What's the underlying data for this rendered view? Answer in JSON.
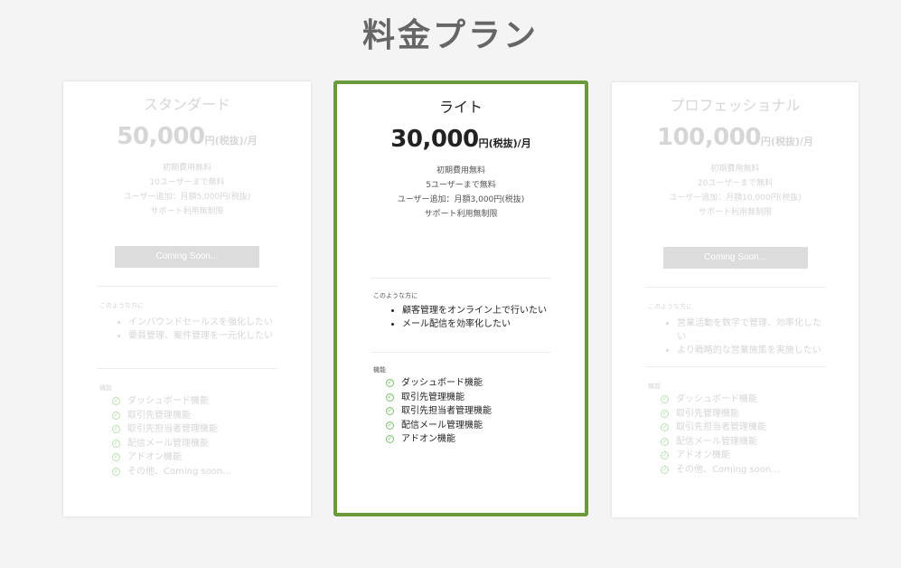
{
  "page": {
    "title": "料金プラン"
  },
  "plans": [
    {
      "name": "スタンダード",
      "price": "50,000",
      "unit": "円(税抜)/月",
      "summary": [
        "初期費用無料",
        "10ユーザーまで無料",
        "ユーザー追加：月額5,000円(税抜)",
        "サポート利用無制限"
      ],
      "cta": "Coming Soon...",
      "target_label": "このような方に",
      "targets": [
        "インバウンドセールスを強化したい",
        "要員管理、案件管理を一元化したい"
      ],
      "features_label": "機能",
      "features": [
        "ダッシュボード機能",
        "取引先管理機能",
        "取引先担当者管理機能",
        "配信メール管理機能",
        "アドオン機能",
        "その他、Coming soon..."
      ]
    },
    {
      "name": "ライト",
      "price": "30,000",
      "unit": "円(税抜)/月",
      "summary": [
        "初期費用無料",
        "5ユーザーまで無料",
        "ユーザー追加：月額3,000円(税抜)",
        "サポート利用無制限"
      ],
      "target_label": "このような方に",
      "targets": [
        "顧客管理をオンライン上で行いたい",
        "メール配信を効率化したい"
      ],
      "features_label": "機能",
      "features": [
        "ダッシュボード機能",
        "取引先管理機能",
        "取引先担当者管理機能",
        "配信メール管理機能",
        "アドオン機能"
      ]
    },
    {
      "name": "プロフェッショナル",
      "price": "100,000",
      "unit": "円(税抜)/月",
      "summary": [
        "初期費用無料",
        "20ユーザーまで無料",
        "ユーザー追加：月額10,000円(税抜)",
        "サポート利用無制限"
      ],
      "cta": "Coming Soon...",
      "target_label": "このような方に",
      "targets": [
        "営業活動を数字で管理、効率化したい",
        "より戦略的な営業施策を実施したい"
      ],
      "features_label": "機能",
      "features": [
        "ダッシュボード機能",
        "取引先管理機能",
        "取引先担当者管理機能",
        "配信メール管理機能",
        "アドオン機能",
        "その他、Coming soon..."
      ]
    }
  ],
  "colors": {
    "accent": "#6a9a3c",
    "check": "#7bbf6a",
    "background": "#f4f4f4"
  }
}
